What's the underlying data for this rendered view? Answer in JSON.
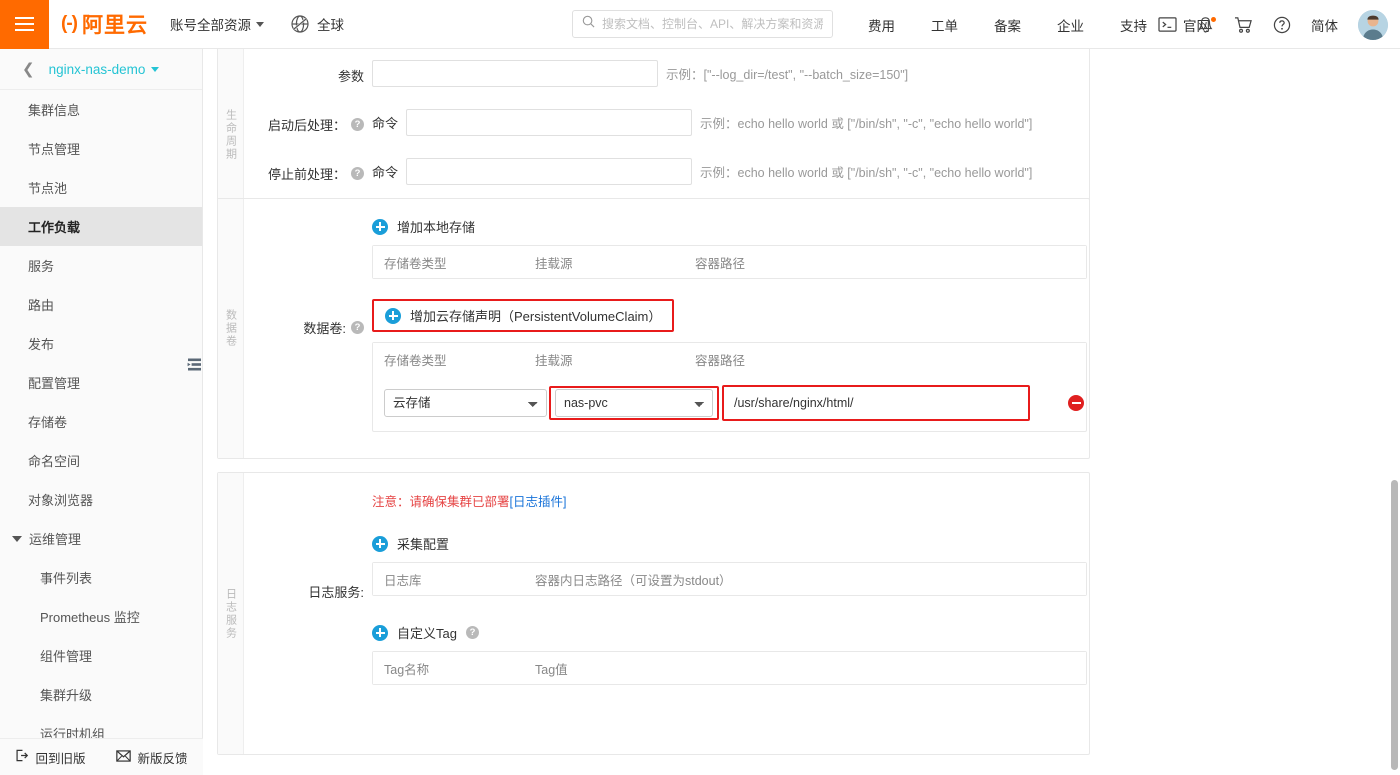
{
  "header": {
    "menu_icon": "hamburger-icon",
    "logo_text": "阿里云",
    "resource_selector": "账号全部资源",
    "region": "全球",
    "search_placeholder": "搜索文档、控制台、API、解决方案和资源",
    "nav": [
      {
        "label": "费用"
      },
      {
        "label": "工单"
      },
      {
        "label": "备案"
      },
      {
        "label": "企业"
      },
      {
        "label": "支持"
      },
      {
        "label": "官网"
      }
    ],
    "language": "简体",
    "icons": [
      "terminal-icon",
      "bell-icon",
      "cart-icon",
      "help-icon"
    ]
  },
  "sidebar": {
    "cluster_name": "nginx-nas-demo",
    "items": [
      {
        "label": "集群信息",
        "active": false,
        "sub": false
      },
      {
        "label": "节点管理",
        "active": false,
        "sub": false
      },
      {
        "label": "节点池",
        "active": false,
        "sub": false
      },
      {
        "label": "工作负载",
        "active": true,
        "sub": false
      },
      {
        "label": "服务",
        "active": false,
        "sub": false
      },
      {
        "label": "路由",
        "active": false,
        "sub": false
      },
      {
        "label": "发布",
        "active": false,
        "sub": false
      },
      {
        "label": "配置管理",
        "active": false,
        "sub": false
      },
      {
        "label": "存储卷",
        "active": false,
        "sub": false
      },
      {
        "label": "命名空间",
        "active": false,
        "sub": false
      },
      {
        "label": "对象浏览器",
        "active": false,
        "sub": false
      }
    ],
    "group_label": "运维管理",
    "group_items": [
      {
        "label": "事件列表"
      },
      {
        "label": "Prometheus 监控"
      },
      {
        "label": "组件管理"
      },
      {
        "label": "集群升级"
      },
      {
        "label": "运行时机组"
      }
    ],
    "footer": {
      "back_label": "回到旧版",
      "feedback_label": "新版反馈"
    }
  },
  "main": {
    "section_lifecycle": {
      "vtab": "生命周期",
      "rows": [
        {
          "label": "参数",
          "sub_label": "",
          "value": "",
          "hint": "示例：[\"--log_dir=/test\", \"--batch_size=150\"]",
          "has_help": false
        },
        {
          "label": "启动后处理：",
          "sub_label": "命令",
          "value": "",
          "hint": "示例：echo hello world 或 [\"/bin/sh\", \"-c\", \"echo hello world\"]",
          "has_help": true
        },
        {
          "label": "停止前处理：",
          "sub_label": "命令",
          "value": "",
          "hint": "示例：echo hello world 或 [\"/bin/sh\", \"-c\", \"echo hello world\"]",
          "has_help": true
        }
      ]
    },
    "section_volume": {
      "vtab": "数据卷",
      "label": "数据卷:",
      "add_local_label": "增加本地存储",
      "add_pvc_label": "增加云存储声明（PersistentVolumeClaim）",
      "columns": [
        "存储卷类型",
        "挂载源",
        "容器路径"
      ],
      "local_rows": [],
      "pvc_rows": [
        {
          "volume_type": "云存储",
          "mount_source": "nas-pvc",
          "container_path": "/usr/share/nginx/html/"
        }
      ]
    },
    "section_log": {
      "vtab": "日志服务",
      "label": "日志服务:",
      "notice_prefix": "注意：请确保集群已部署",
      "notice_link": "[日志插件]",
      "collect_label": "采集配置",
      "collect_columns": [
        "日志库",
        "容器内日志路径（可设置为stdout）"
      ],
      "tag_label": "自定义Tag",
      "tag_columns": [
        "Tag名称",
        "Tag值"
      ]
    }
  },
  "colors": {
    "brand_orange": "#ff6a00",
    "link_teal": "#25c4d4",
    "add_blue": "#1a9ed9",
    "remove_red": "#e02020",
    "highlight_red": "#e81b1b",
    "notice_red": "#e64545",
    "notice_link_blue": "#1a74d9"
  }
}
